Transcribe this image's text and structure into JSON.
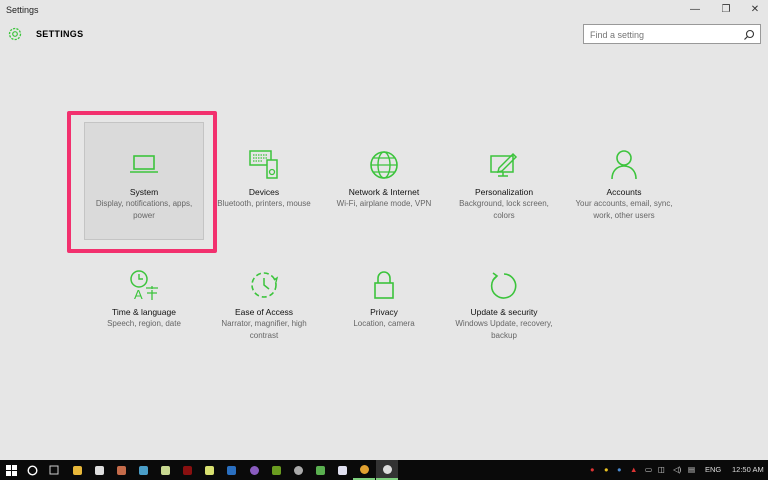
{
  "window": {
    "title": "Settings",
    "minimize": "—",
    "restore": "❐",
    "close": "✕"
  },
  "header": {
    "title": "SETTINGS",
    "search_placeholder": "Find a setting"
  },
  "accent": "#3cc43c",
  "highlight": "#f2306e",
  "tiles": [
    {
      "title": "System",
      "desc": "Display, notifications, apps, power",
      "icon": "laptop-icon"
    },
    {
      "title": "Devices",
      "desc": "Bluetooth, printers, mouse",
      "icon": "devices-icon"
    },
    {
      "title": "Network & Internet",
      "desc": "Wi-Fi, airplane mode, VPN",
      "icon": "globe-icon"
    },
    {
      "title": "Personalization",
      "desc": "Background, lock screen, colors",
      "icon": "paint-icon"
    },
    {
      "title": "Accounts",
      "desc": "Your accounts, email, sync, work, other users",
      "icon": "person-icon"
    },
    {
      "title": "Time & language",
      "desc": "Speech, region, date",
      "icon": "time-language-icon"
    },
    {
      "title": "Ease of Access",
      "desc": "Narrator, magnifier, high contrast",
      "icon": "ease-of-access-icon"
    },
    {
      "title": "Privacy",
      "desc": "Location, camera",
      "icon": "lock-icon"
    },
    {
      "title": "Update & security",
      "desc": "Windows Update, recovery, backup",
      "icon": "update-icon"
    }
  ],
  "taskbar": {
    "language": "ENG",
    "time": "12:50 AM"
  }
}
